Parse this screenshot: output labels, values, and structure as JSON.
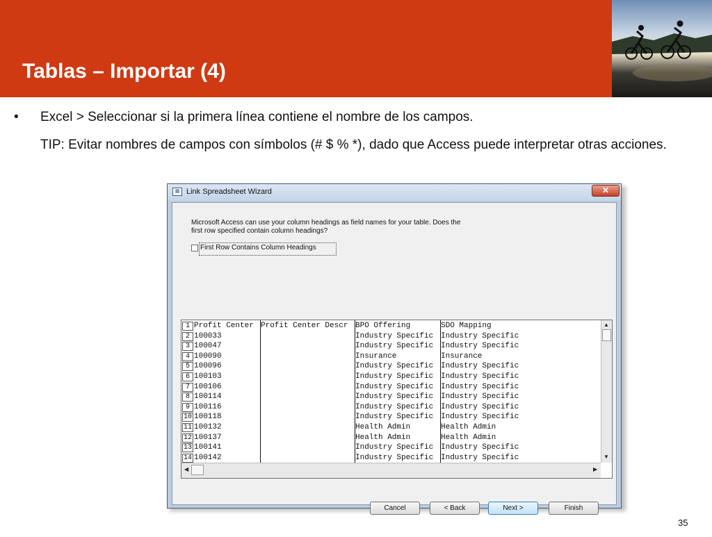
{
  "slide": {
    "title": "Tablas – Importar (4)",
    "bullet": "Excel > Seleccionar si la primera línea contiene el nombre de los campos.",
    "bullet_marker": "•",
    "tip": "TIP: Evitar nombres de campos con símbolos (# $ % *), dado que Access puede interpretar otras acciones.",
    "page_number": "35",
    "header_color": "#cf3a13"
  },
  "dialog": {
    "title": "Link Spreadsheet Wizard",
    "close_label": "✕",
    "prompt": "Microsoft Access can use your column headings as field names for your table. Does the first row specified contain column headings?",
    "checkbox_label": "First Row Contains Column Headings",
    "checkbox_checked": false,
    "grid": {
      "row_numbers": [
        "1",
        "2",
        "3",
        "4",
        "5",
        "6",
        "7",
        "8",
        "9",
        "10",
        "11",
        "12",
        "13",
        "14"
      ],
      "columns": [
        [
          "Profit Center",
          "100033",
          "100047",
          "100090",
          "100096",
          "100103",
          "100106",
          "100114",
          "100116",
          "100118",
          "100132",
          "100137",
          "100141",
          "100142"
        ],
        [
          "Profit Center Descr",
          "",
          "",
          "",
          "",
          "",
          "",
          "",
          "",
          "",
          "",
          "",
          "",
          ""
        ],
        [
          "BPO Offering",
          "Industry Specific",
          "Industry Specific",
          "Insurance",
          "Industry Specific",
          "Industry Specific",
          "Industry Specific",
          "Industry Specific",
          "Industry Specific",
          "Industry Specific",
          "Health Admin",
          "Health Admin",
          "Industry Specific",
          "Industry Specific"
        ],
        [
          "SDO Mapping",
          "Industry Specific",
          "Industry Specific",
          "Insurance",
          "Industry Specific",
          "Industry Specific",
          "Industry Specific",
          "Industry Specific",
          "Industry Specific",
          "Industry Specific",
          "Health Admin",
          "Health Admin",
          "Industry Specific",
          "Industry Specific"
        ]
      ]
    },
    "buttons": {
      "cancel": "Cancel",
      "back": "< Back",
      "next": "Next >",
      "finish": "Finish"
    }
  },
  "icons": [
    "photo-cyclists",
    "close-icon",
    "scroll-up-icon",
    "scroll-down-icon",
    "scroll-left-icon",
    "scroll-right-icon"
  ]
}
